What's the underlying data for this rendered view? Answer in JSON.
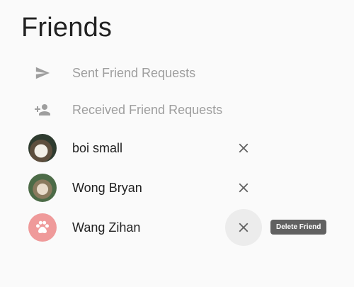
{
  "page": {
    "title": "Friends"
  },
  "nav": {
    "sent_label": "Sent Friend Requests",
    "received_label": "Received Friend Requests",
    "sent_icon": "send-icon",
    "received_icon": "person-add-icon"
  },
  "friends": [
    {
      "name": "boi small",
      "avatar": "dog-photo-avatar"
    },
    {
      "name": "Wong Bryan",
      "avatar": "dog-photo-avatar"
    },
    {
      "name": "Wang Zihan",
      "avatar": "paw-icon-avatar"
    }
  ],
  "tooltip": {
    "delete_label": "Delete Friend"
  },
  "colors": {
    "background": "#fafafa",
    "muted_text": "#9e9e9e",
    "icon_gray": "#9e9e9e",
    "close_icon": "#616161",
    "paw_avatar_bg": "#ef9a9a",
    "tooltip_bg": "#616161"
  }
}
